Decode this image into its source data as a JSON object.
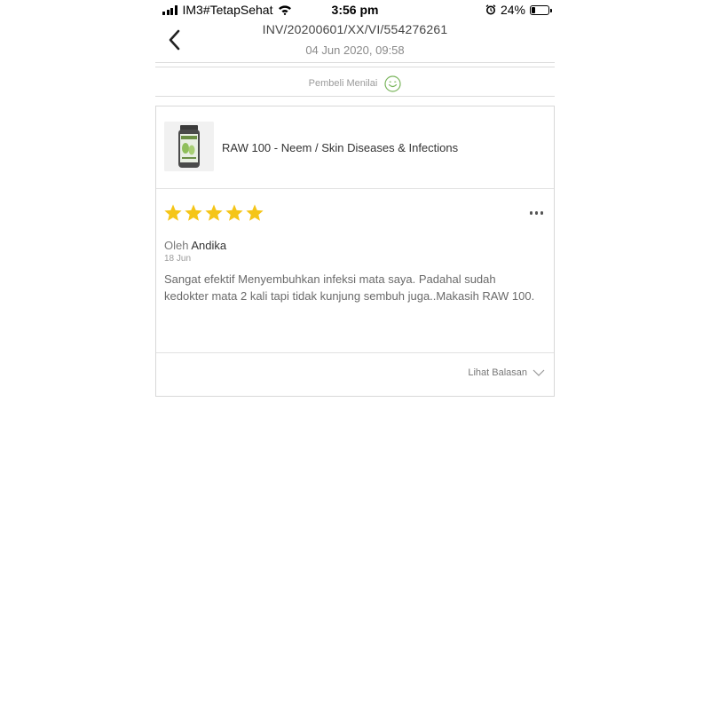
{
  "status_bar": {
    "carrier": "IM3#TetapSehat",
    "time": "3:56 pm",
    "battery": "24%",
    "battery_level": 0.24
  },
  "header": {
    "invoice": "INV/20200601/XX/VI/554276261",
    "datetime": "04 Jun 2020, 09:58",
    "back_icon": "chevron-left-icon"
  },
  "rating_status": {
    "label": "Pembeli Menilai",
    "icon": "smiley-icon",
    "icon_color": "#7ab55c"
  },
  "product": {
    "name": "RAW 100 - Neem / Skin Diseases & Infections"
  },
  "review": {
    "stars": 5,
    "star_color": "#f5c518",
    "by_prefix": "Oleh",
    "author": "Andika",
    "date": "18 Jun",
    "text": "Sangat efektif Menyembuhkan infeksi mata saya. Padahal sudah kedokter mata 2 kali tapi tidak kunjung sembuh juga..Makasih RAW 100."
  },
  "footer": {
    "see_reply": "Lihat Balasan"
  }
}
